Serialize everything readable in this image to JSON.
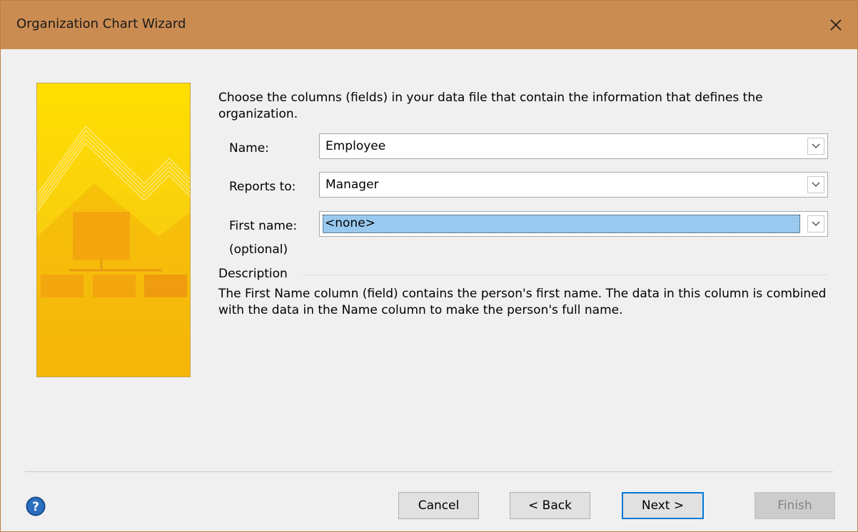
{
  "window": {
    "title": "Organization Chart Wizard"
  },
  "instructions": "Choose the columns (fields) in your data file that contain the information that defines the organization.",
  "fields": {
    "name": {
      "label": "Name:",
      "value": "Employee"
    },
    "reports_to": {
      "label": "Reports to:",
      "value": "Manager"
    },
    "first_name": {
      "label": "First name:",
      "sublabel": "(optional)",
      "value": "<none>"
    }
  },
  "description": {
    "title": "Description",
    "text": "The First Name column (field) contains the person's first name. The data in this column is combined with the data in the Name column to make the person's full name."
  },
  "buttons": {
    "cancel": "Cancel",
    "back": "< Back",
    "next": "Next >",
    "finish": "Finish"
  },
  "icons": {
    "close": "close-icon",
    "help": "help-icon",
    "dropdown": "chevron-down-icon",
    "wizard_art": "org-chart-illustration"
  },
  "colors": {
    "titlebar": "#cb8c52",
    "accent": "#0078d7",
    "selection": "#99c9ef",
    "art_yellow": "#f9c80e"
  }
}
